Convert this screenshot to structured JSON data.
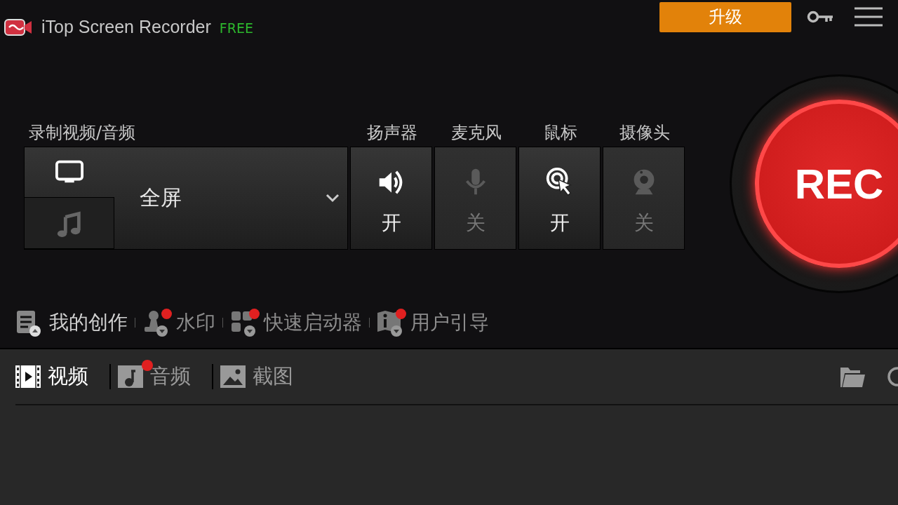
{
  "app": {
    "title": "iTop Screen Recorder",
    "edition": "FREE",
    "upgrade_button": "升级"
  },
  "record": {
    "label": "录制视频/音频",
    "mode": "全屏",
    "sources": [
      {
        "kind": "screen",
        "selected": true
      },
      {
        "kind": "audio",
        "selected": false
      }
    ]
  },
  "toggles": [
    {
      "label": "扬声器",
      "kind": "speaker",
      "on": true,
      "state": "开"
    },
    {
      "label": "麦克风",
      "kind": "mic",
      "on": false,
      "state": "关"
    },
    {
      "label": "鼠标",
      "kind": "mouse",
      "on": true,
      "state": "开"
    },
    {
      "label": "摄像头",
      "kind": "webcam",
      "on": false,
      "state": "关"
    }
  ],
  "rec_button": "REC",
  "tools": [
    {
      "label": "我的创作",
      "kind": "creations",
      "selected": true,
      "badge": false
    },
    {
      "label": "水印",
      "kind": "watermark",
      "selected": false,
      "badge": true
    },
    {
      "label": "快速启动器",
      "kind": "launcher",
      "selected": false,
      "badge": true
    },
    {
      "label": "用户引导",
      "kind": "guide",
      "selected": false,
      "badge": true
    }
  ],
  "media_tabs": [
    {
      "label": "视频",
      "kind": "video",
      "selected": true,
      "badge": false
    },
    {
      "label": "音频",
      "kind": "audio",
      "selected": false,
      "badge": true
    },
    {
      "label": "截图",
      "kind": "screenshot",
      "selected": false,
      "badge": false
    }
  ]
}
